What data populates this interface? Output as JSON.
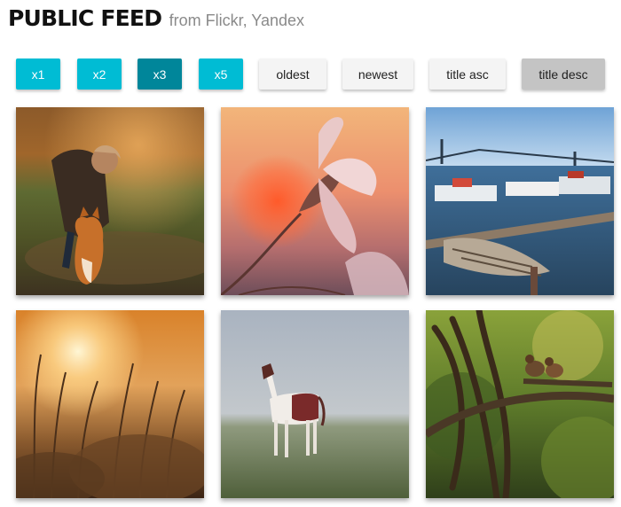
{
  "header": {
    "title": "PUBLIC FEED",
    "subtitle": "from Flickr, Yandex"
  },
  "toolbar": {
    "zoom_buttons": [
      {
        "label": "x1",
        "active": false
      },
      {
        "label": "x2",
        "active": false
      },
      {
        "label": "x3",
        "active": true
      },
      {
        "label": "x5",
        "active": false
      }
    ],
    "sort_buttons": [
      {
        "label": "oldest",
        "active": false
      },
      {
        "label": "newest",
        "active": false
      },
      {
        "label": "title asc",
        "active": false
      },
      {
        "label": "title desc",
        "active": true
      }
    ]
  },
  "colors": {
    "accent": "#00bcd4",
    "accent_active": "#00869a",
    "sort_button": "#f4f4f4",
    "sort_button_active": "#c4c4c4"
  },
  "feed": {
    "items": [
      {
        "subject": "child-with-cat"
      },
      {
        "subject": "flower-sunset"
      },
      {
        "subject": "harbor-boats"
      },
      {
        "subject": "sunset-grass"
      },
      {
        "subject": "horse-in-fog"
      },
      {
        "subject": "ducks-on-branch"
      }
    ]
  }
}
